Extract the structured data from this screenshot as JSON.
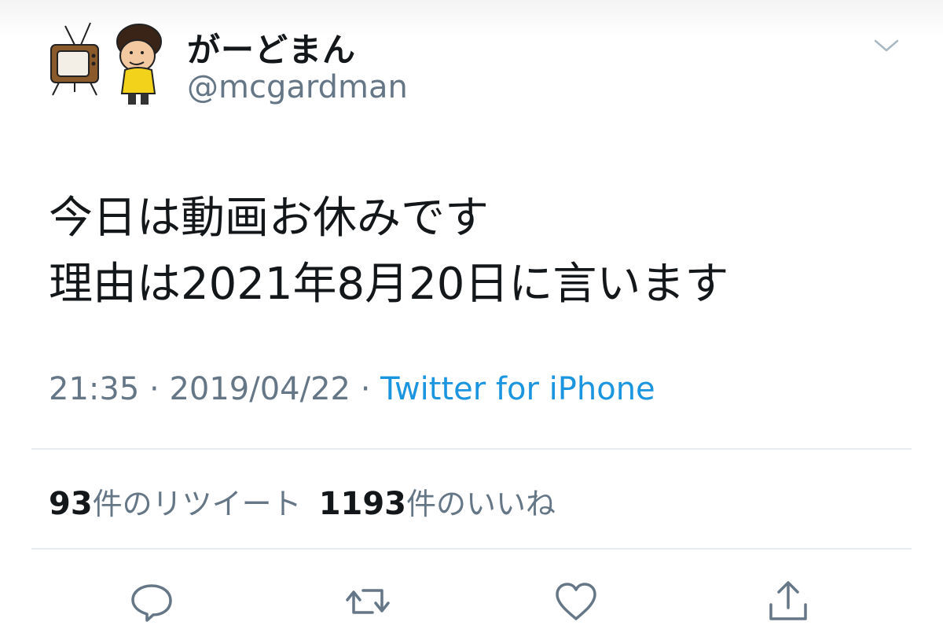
{
  "author": {
    "display_name": "がーどまん",
    "handle": "@mcgardman"
  },
  "tweet": {
    "lines": [
      "今日は動画お休みです",
      "理由は2021年8月20日に言います"
    ],
    "time": "21:35",
    "separator": "·",
    "date": "2019/04/22",
    "source": "Twitter for iPhone"
  },
  "stats": {
    "retweet_count": "93",
    "retweet_label": "件のリツイート",
    "like_count": "1193",
    "like_label": "件のいいね"
  },
  "icons": {
    "caret": "chevron-down-icon",
    "reply": "reply-icon",
    "retweet": "retweet-icon",
    "like": "heart-icon",
    "share": "share-icon"
  },
  "colors": {
    "text": "#14171a",
    "secondary": "#657786",
    "link": "#1b95e0",
    "divider": "#e6ecf0"
  }
}
